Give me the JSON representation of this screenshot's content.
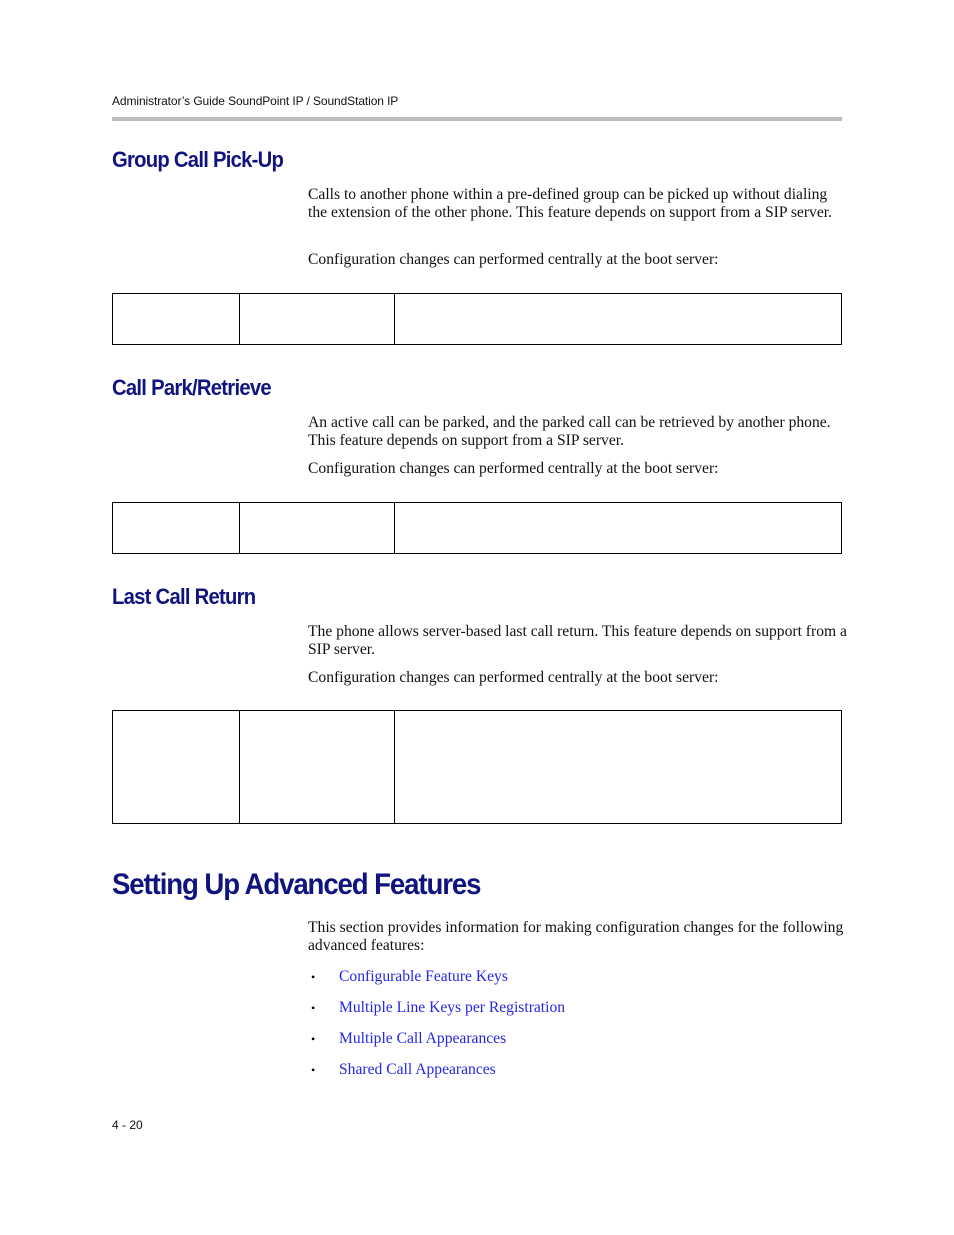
{
  "header": {
    "running_title": "Administrator’s Guide SoundPoint IP / SoundStation IP"
  },
  "sections": [
    {
      "heading": "Group Call Pick-Up",
      "paragraphs": [
        "Calls to another phone within a pre-defined group can be picked up without dialing the extension of the other phone. This feature depends on support from a SIP server.",
        "Configuration changes can performed centrally at the boot server:"
      ],
      "table": {
        "rows": [
          [
            "",
            "",
            ""
          ]
        ]
      }
    },
    {
      "heading": "Call Park/Retrieve",
      "paragraphs": [
        "An active call can be parked, and the parked call can be retrieved by another phone. This feature depends on support from a SIP server.",
        "Configuration changes can performed centrally at the boot server:"
      ],
      "table": {
        "rows": [
          [
            "",
            "",
            ""
          ]
        ]
      }
    },
    {
      "heading": "Last Call Return",
      "paragraphs": [
        "The phone allows server-based last call return. This feature depends on support from a SIP server.",
        "Configuration changes can performed centrally at the boot server:"
      ],
      "table": {
        "rows": [
          [
            "",
            "",
            ""
          ]
        ]
      }
    }
  ],
  "advanced": {
    "heading": "Setting Up Advanced Features",
    "intro": "This section provides information for making configuration changes for the following advanced features:",
    "bullet_glyph": "•",
    "links": [
      "Configurable Feature Keys",
      "Multiple Line Keys per Registration",
      "Multiple Call Appearances",
      "Shared Call Appearances"
    ]
  },
  "footer": {
    "page_number": "4 - 20"
  },
  "colors": {
    "heading": "#10147e",
    "link": "#2626e6",
    "header_rule": "#bdbdbd"
  }
}
